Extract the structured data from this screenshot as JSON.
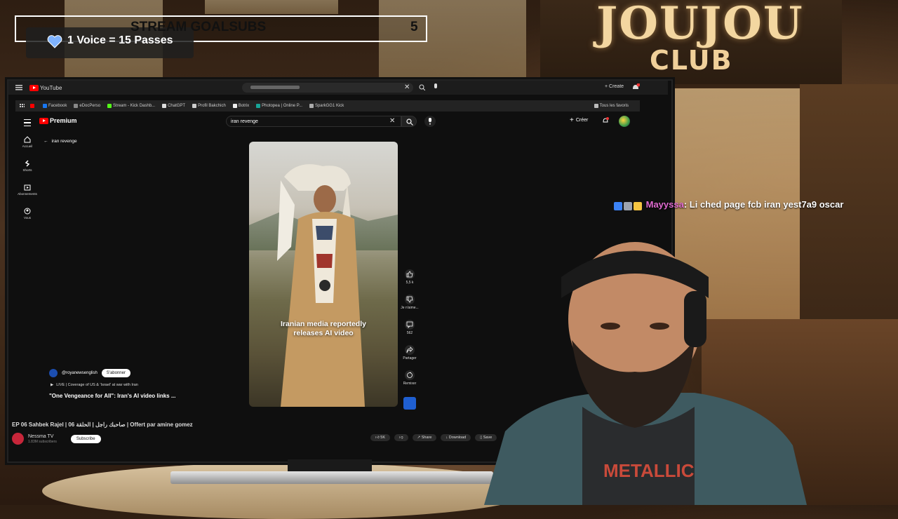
{
  "overlay": {
    "goal_label": "STREAM GOALSUBS",
    "goal_count": "5",
    "voice_text": "1 Voice = 15 Passes"
  },
  "sign": {
    "line1": "JOUJOU",
    "line2": "CLUB"
  },
  "outer_app": {
    "logo": "YouTube",
    "create_label": "+ Create"
  },
  "bookmarks": [
    "Facebook",
    "eDocPerso",
    "Stream - Kick Dashb...",
    "ChatGPT",
    "Profil Bakchich",
    "Botrix",
    "Photopea | Online P...",
    "SparkGG1 Kick"
  ],
  "bookmarks_right": "Tous les favoris",
  "youtube": {
    "logo": "Premium",
    "search_value": "iran revenge",
    "create_label": "Créer",
    "back_label": "iran revenge",
    "side_nav": [
      {
        "icon": "home-icon",
        "label": "Accueil"
      },
      {
        "icon": "shorts-icon",
        "label": "Shorts"
      },
      {
        "icon": "subscriptions-icon",
        "label": "Abonnements"
      },
      {
        "icon": "you-icon",
        "label": "Vous"
      }
    ],
    "short": {
      "caption_line1": "Iranian media reportedly",
      "caption_line2": "releases AI video",
      "channel": "@royanewsenglish",
      "subscribe": "S'abonner",
      "live_text": "LIVE | Coverage of US & 'Israel' at war with Iran",
      "title": "\"One Vengeance for All\": Iran's AI video links ..."
    },
    "actions": [
      {
        "icon": "like-icon",
        "label": "5,5 k"
      },
      {
        "icon": "dislike-icon",
        "label": "Je n'aime..."
      },
      {
        "icon": "comment-icon",
        "label": "562"
      },
      {
        "icon": "share-icon",
        "label": "Partager"
      },
      {
        "icon": "remix-icon",
        "label": "Remixer"
      }
    ]
  },
  "outer_player": {
    "title": "EP 06 Sahbek Rajel | صاحبك راجل | الحلقة 06 | Offert par amine gomez",
    "channel": "Nessma TV",
    "subscribers": "1.83M subscribers",
    "subscribe": "Subscribe",
    "actions": [
      "5K",
      "",
      "Share",
      "Download",
      "Save"
    ]
  },
  "chat": {
    "user": "Mayyssa",
    "message": ": Li ched page fcb iran yest7a9 oscar",
    "user_color": "#e06ad0"
  }
}
